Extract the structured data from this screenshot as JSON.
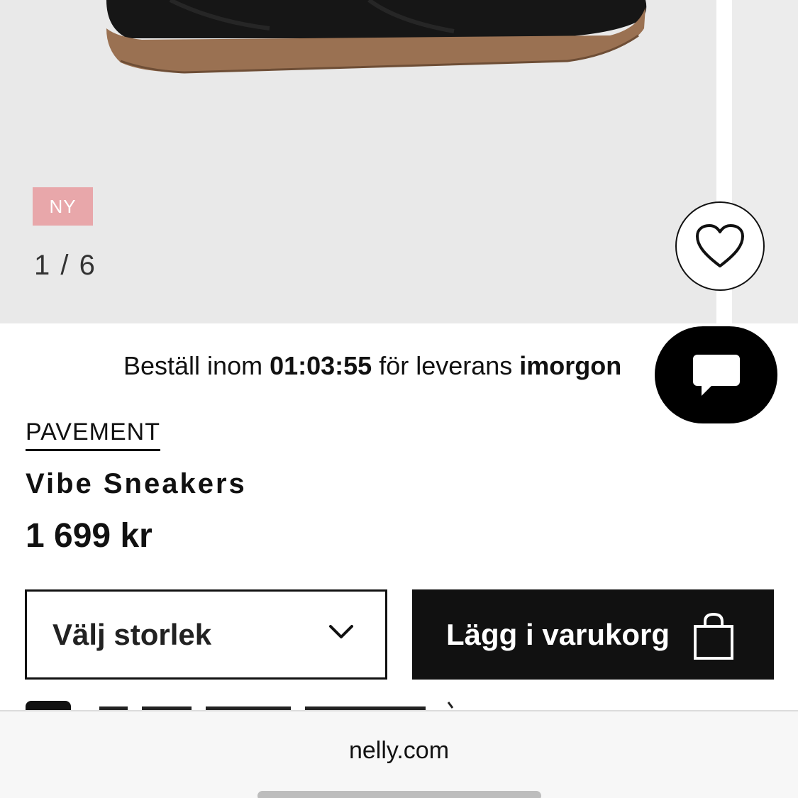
{
  "gallery": {
    "badge": "NY",
    "counter": "1 / 6"
  },
  "delivery": {
    "prefix": "Beställ inom ",
    "time": "01:03:55",
    "middle": " för leverans ",
    "when": "imorgon"
  },
  "product": {
    "brand": "PAVEMENT",
    "title": "Vibe Sneakers",
    "price": "1 699 kr"
  },
  "actions": {
    "size_label": "Välj storlek",
    "cart_label": "Lägg i varukorg"
  },
  "browser": {
    "url": "nelly.com"
  },
  "icons": {
    "favorite": "heart-icon",
    "chat": "chat-bubble-icon",
    "dropdown": "chevron-down-icon",
    "cart": "shopping-bag-icon"
  },
  "colors": {
    "badge_bg": "#e8a7aa",
    "primary": "#111111",
    "image_bg": "#e9e9e9"
  }
}
